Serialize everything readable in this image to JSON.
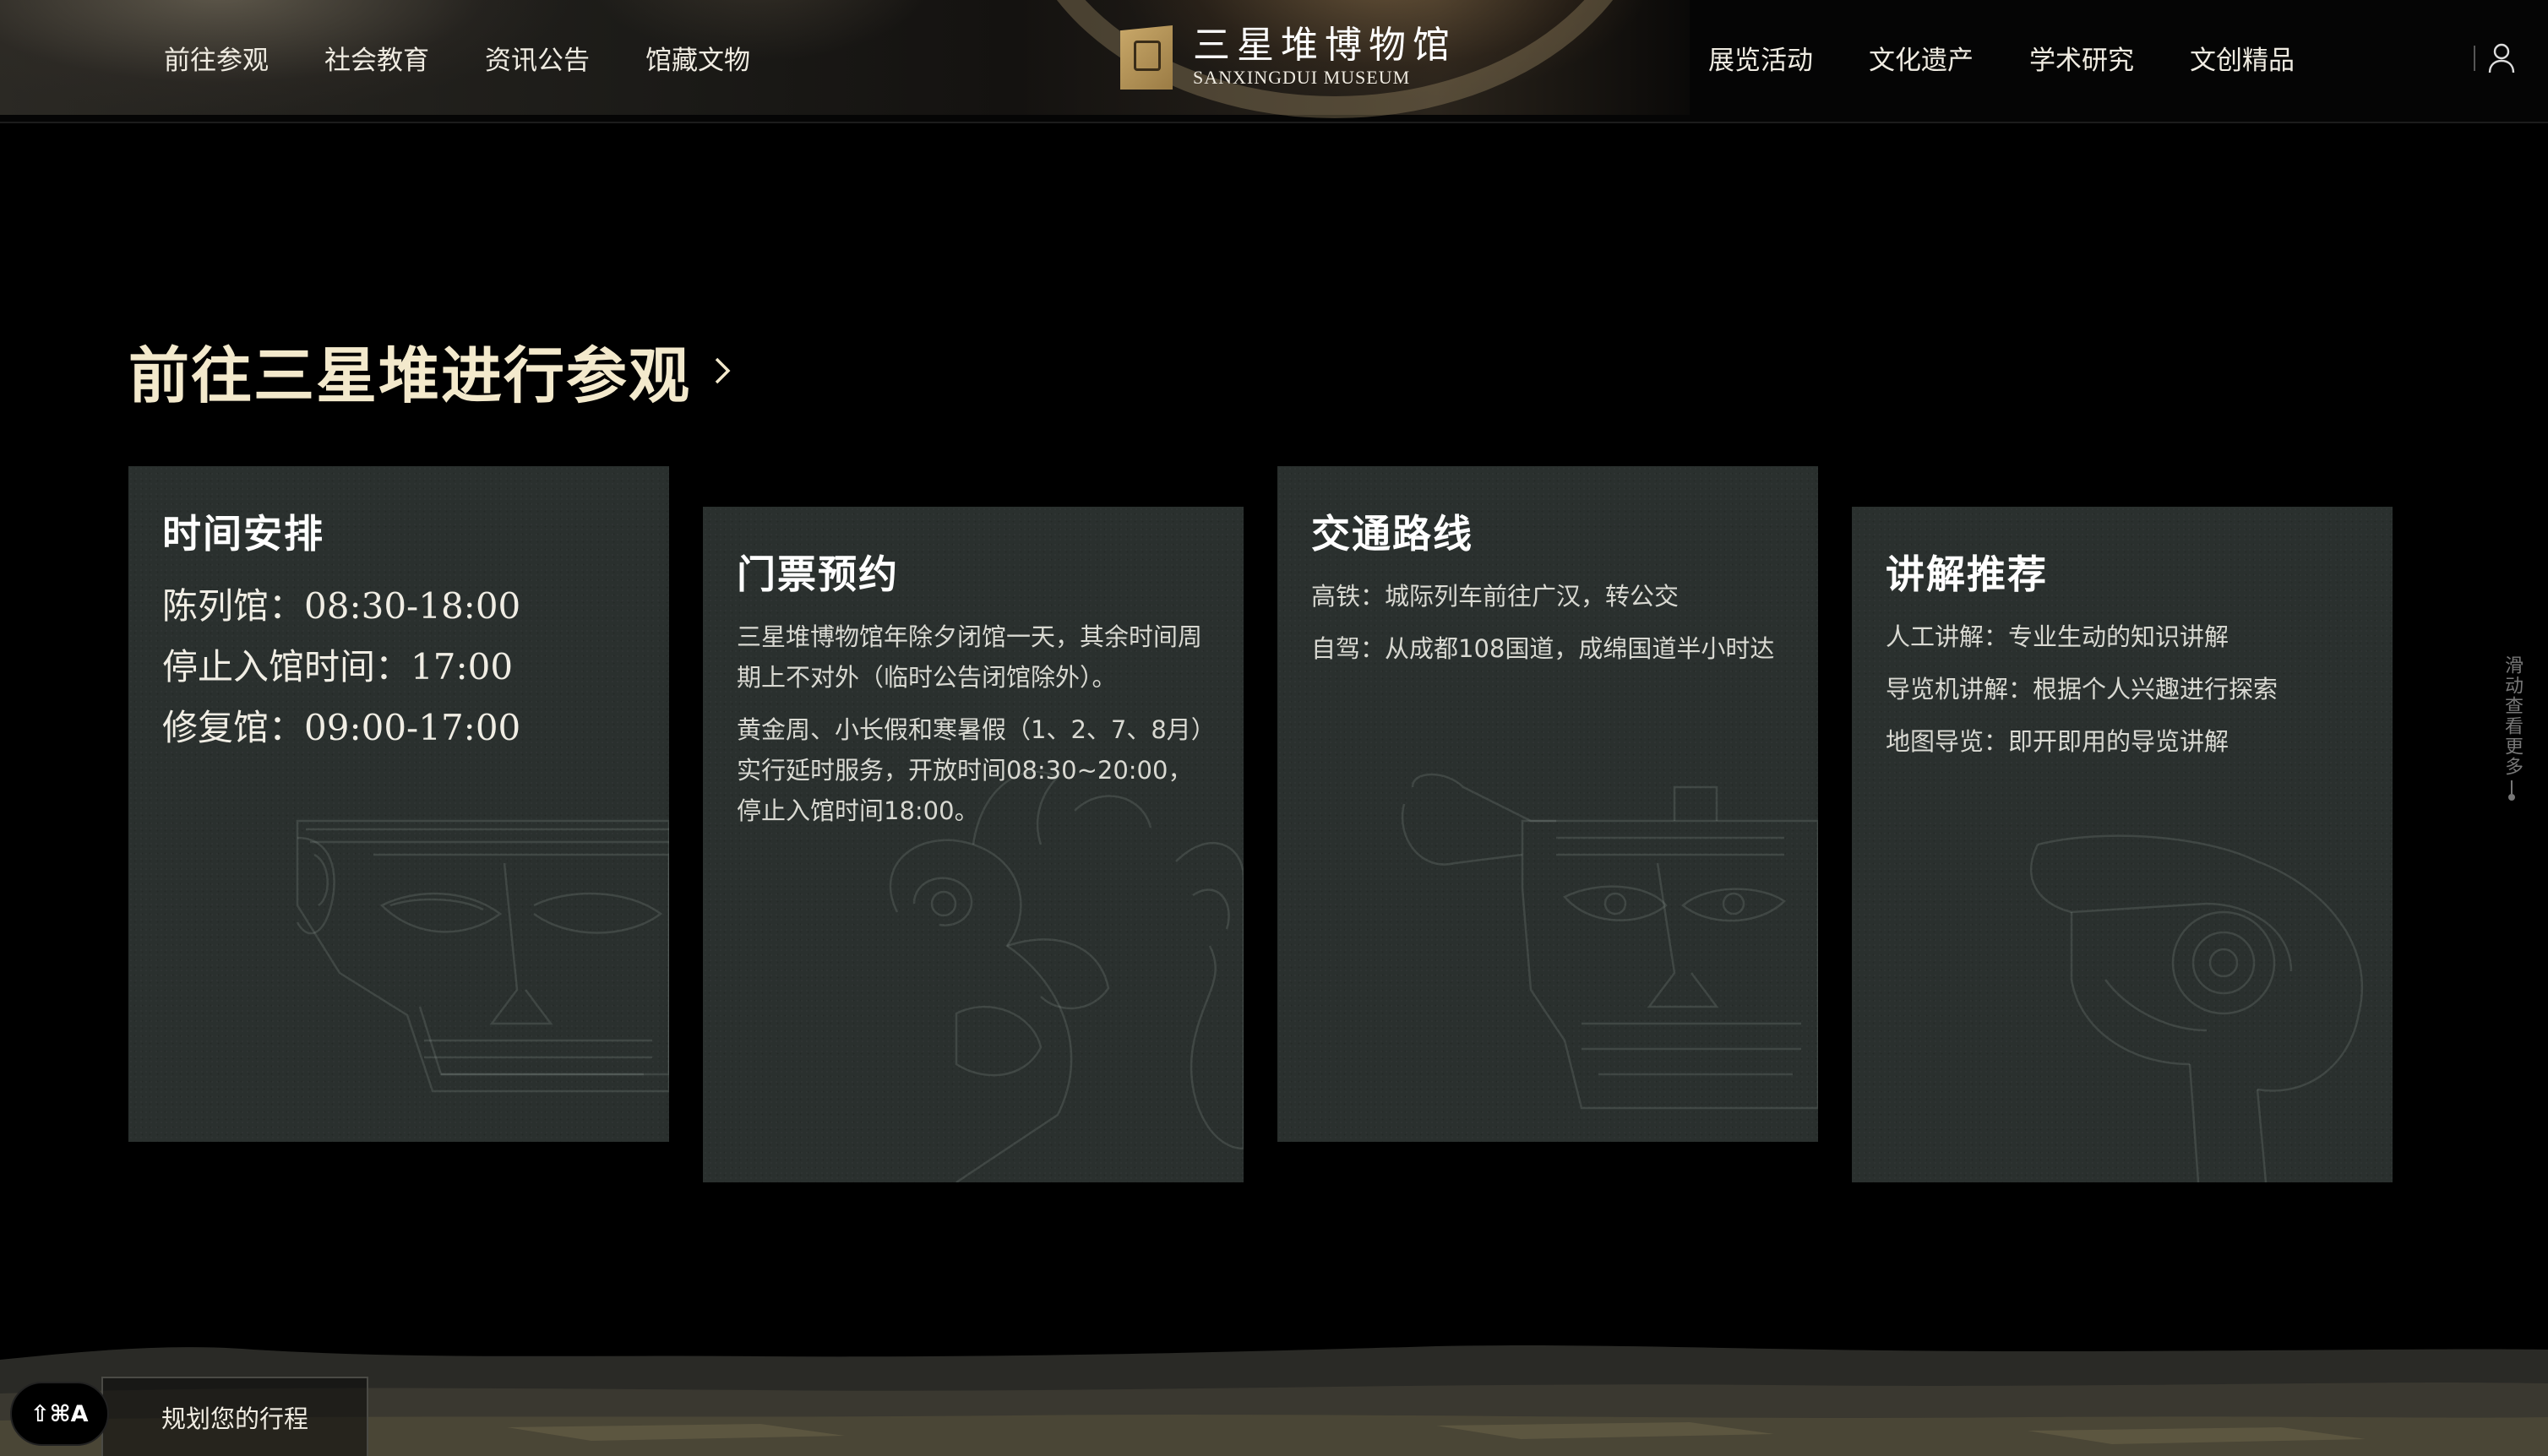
{
  "header": {
    "nav_left": [
      "前往参观",
      "社会教育",
      "资讯公告",
      "馆藏文物"
    ],
    "nav_right": [
      "展览活动",
      "文化遗产",
      "学术研究",
      "文创精品"
    ],
    "logo": {
      "cn": "三星堆博物馆",
      "en": "SANXINGDUI MUSEUM"
    },
    "user_icon": "user-icon"
  },
  "section": {
    "title": "前往三星堆进行参观",
    "chevron_icon": "chevron-right-icon"
  },
  "cards": [
    {
      "title": "时间安排",
      "lines": [
        "陈列馆：08:30-18:00",
        "停止入馆时间：17:00",
        "修复馆：09:00-17:00"
      ]
    },
    {
      "title": "门票预约",
      "lines": [
        "三星堆博物馆年除夕闭馆一天，其余时间周期上不对外（临时公告闭馆除外）。",
        "黄金周、小长假和寒暑假（1、2、7、8月）实行延时服务，开放时间08:30~20:00，停止入馆时间18:00。"
      ]
    },
    {
      "title": "交通路线",
      "lines": [
        "高铁：城际列车前往广汉，转公交",
        "自驾：从成都108国道，成绵国道半小时达"
      ]
    },
    {
      "title": "讲解推荐",
      "lines": [
        "人工讲解：专业生动的知识讲解",
        "导览机讲解：根据个人兴趣进行探索",
        "地图导览：即开即用的导览讲解"
      ]
    }
  ],
  "scroll_hint": "滑动查看更多",
  "bottom": {
    "plan_trip": "规划您的行程",
    "shortcut": "⇧⌘A"
  },
  "colors": {
    "background": "#000000",
    "card": "#2a302e",
    "title": "#f3e9cc",
    "logo_gold": "#c9a869"
  }
}
